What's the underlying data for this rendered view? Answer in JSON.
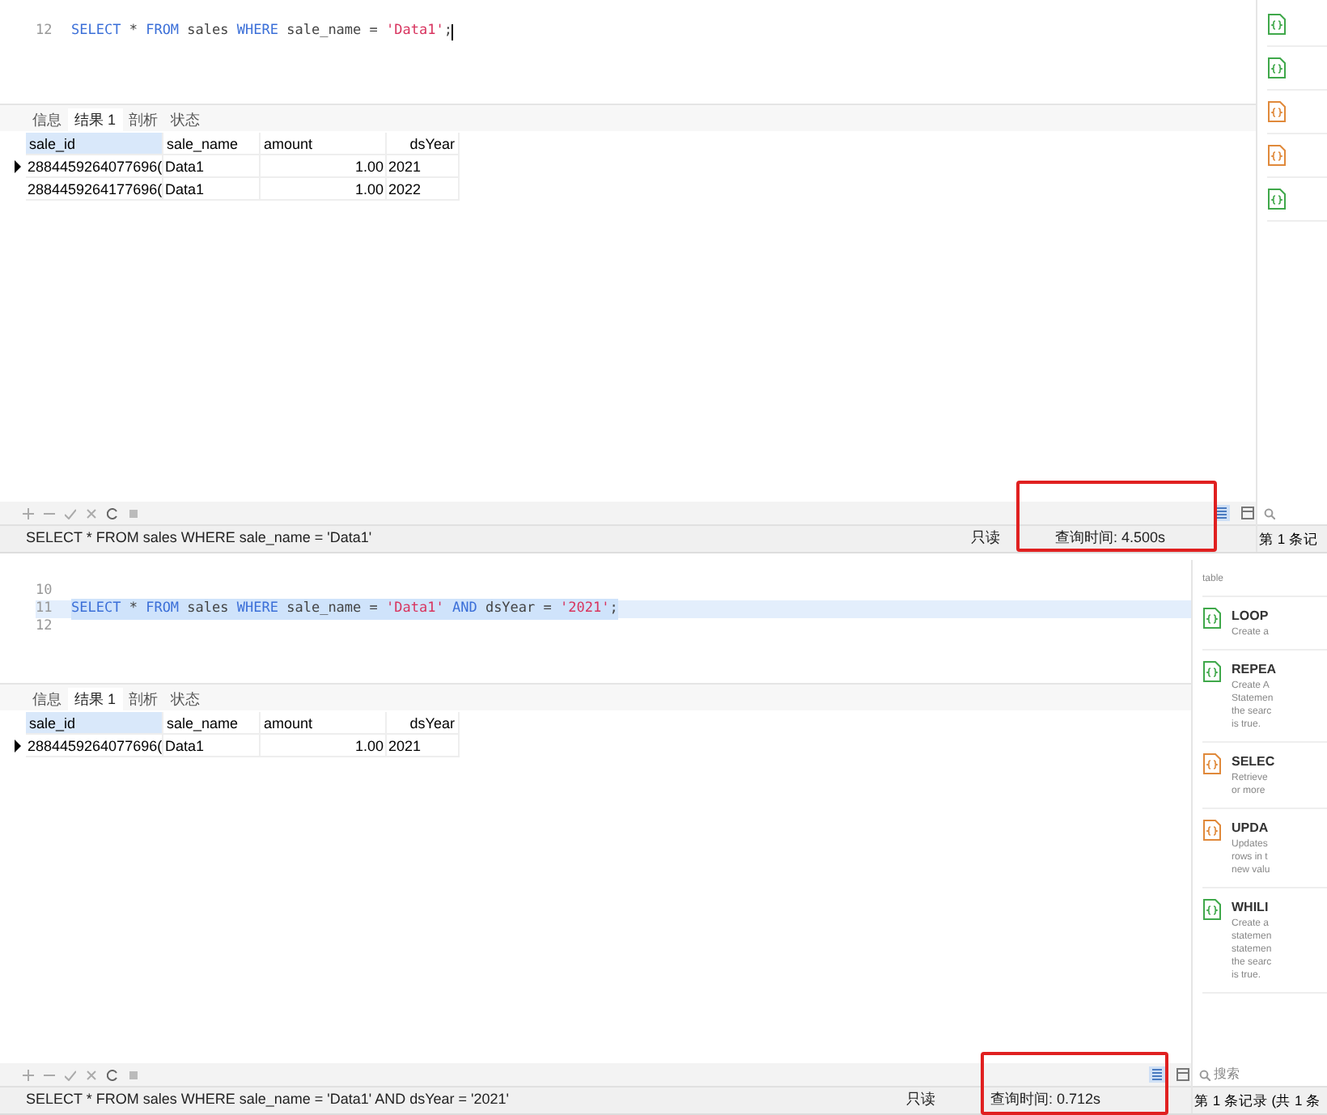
{
  "panels": [
    {
      "editor": {
        "lines": [
          {
            "number": "12",
            "selected": false,
            "cursor": true,
            "tokens": [
              {
                "text": "SELECT",
                "kind": "keyword"
              },
              {
                "text": " * ",
                "kind": "plain"
              },
              {
                "text": "FROM",
                "kind": "keyword"
              },
              {
                "text": " sales ",
                "kind": "plain"
              },
              {
                "text": "WHERE",
                "kind": "keyword"
              },
              {
                "text": " sale_name = ",
                "kind": "plain"
              },
              {
                "text": "'Data1'",
                "kind": "string"
              },
              {
                "text": ";",
                "kind": "plain"
              }
            ]
          }
        ]
      },
      "tabs": [
        {
          "label": "信息",
          "selected": false
        },
        {
          "label": "结果 1",
          "selected": true
        },
        {
          "label": "剖析",
          "selected": false
        },
        {
          "label": "状态",
          "selected": false
        }
      ],
      "table": {
        "columns": [
          {
            "label": "sale_id",
            "selected": true
          },
          {
            "label": "sale_name",
            "selected": false
          },
          {
            "label": "amount",
            "selected": false
          },
          {
            "label": "dsYear",
            "selected": false
          }
        ],
        "rows": [
          {
            "current": true,
            "cells": [
              "2884459264077696(",
              "Data1",
              "1.00",
              "2021"
            ]
          },
          {
            "current": false,
            "cells": [
              "2884459264177696(",
              "Data1",
              "1.00",
              "2022"
            ]
          }
        ]
      },
      "status": {
        "sql": "SELECT * FROM sales WHERE sale_name = 'Data1'",
        "readonly": "只读",
        "query_time": "查询时间: 4.500s",
        "highlighted": true,
        "records": "第 1 条记"
      },
      "sidebar": {
        "snippets": [
          {
            "color": "#3fa84a"
          },
          {
            "color": "#3fa84a"
          },
          {
            "color": "#e0893a"
          },
          {
            "color": "#e0893a"
          },
          {
            "color": "#3fa84a"
          }
        ]
      }
    },
    {
      "editor": {
        "lines": [
          {
            "number": "10",
            "selected": false,
            "cursor": false
          },
          {
            "number": "11",
            "selected": true,
            "cursor": false,
            "tokens": [
              {
                "text": "SELECT",
                "kind": "keyword"
              },
              {
                "text": " * ",
                "kind": "plain"
              },
              {
                "text": "FROM",
                "kind": "keyword"
              },
              {
                "text": " sales ",
                "kind": "plain"
              },
              {
                "text": "WHERE",
                "kind": "keyword"
              },
              {
                "text": " sale_name = ",
                "kind": "plain"
              },
              {
                "text": "'Data1'",
                "kind": "string"
              },
              {
                "text": " AND",
                "kind": "keyword"
              },
              {
                "text": " dsYear = ",
                "kind": "plain"
              },
              {
                "text": "'2021'",
                "kind": "string"
              },
              {
                "text": ";",
                "kind": "plain"
              }
            ]
          },
          {
            "number": "12",
            "selected": false,
            "cursor": false
          }
        ]
      },
      "tabs": [
        {
          "label": "信息",
          "selected": false
        },
        {
          "label": "结果 1",
          "selected": true
        },
        {
          "label": "剖析",
          "selected": false
        },
        {
          "label": "状态",
          "selected": false
        }
      ],
      "table": {
        "columns": [
          {
            "label": "sale_id",
            "selected": true
          },
          {
            "label": "sale_name",
            "selected": false
          },
          {
            "label": "amount",
            "selected": false
          },
          {
            "label": "dsYear",
            "selected": false
          }
        ],
        "rows": [
          {
            "current": true,
            "cells": [
              "2884459264077696(",
              "Data1",
              "1.00",
              "2021"
            ]
          }
        ]
      },
      "status": {
        "sql": "SELECT * FROM sales WHERE sale_name = 'Data1' AND dsYear = '2021'",
        "readonly": "只读",
        "query_time": "查询时间: 0.712s",
        "highlighted": true,
        "records": "第 1 条记录 (共 1 条"
      },
      "search": {
        "placeholder": "搜索"
      },
      "sidebar": {
        "snippets": [
          {
            "description": [
              "table"
            ]
          },
          {
            "color": "#3fa84a",
            "title": "LOOP",
            "description": [
              "Create a"
            ]
          },
          {
            "color": "#3fa84a",
            "title": "REPEA",
            "description": [
              "Create A",
              "Statemen",
              "the searc",
              "is true."
            ]
          },
          {
            "color": "#e0893a",
            "title": "SELEC",
            "description": [
              "Retrieve",
              "or more"
            ]
          },
          {
            "color": "#e0893a",
            "title": "UPDA",
            "description": [
              "Updates",
              "rows in t",
              "new valu"
            ]
          },
          {
            "color": "#3fa84a",
            "title": "WHILI",
            "description": [
              "Create a",
              "statemen",
              "statemen",
              "the searc",
              "is true."
            ]
          }
        ]
      }
    }
  ]
}
